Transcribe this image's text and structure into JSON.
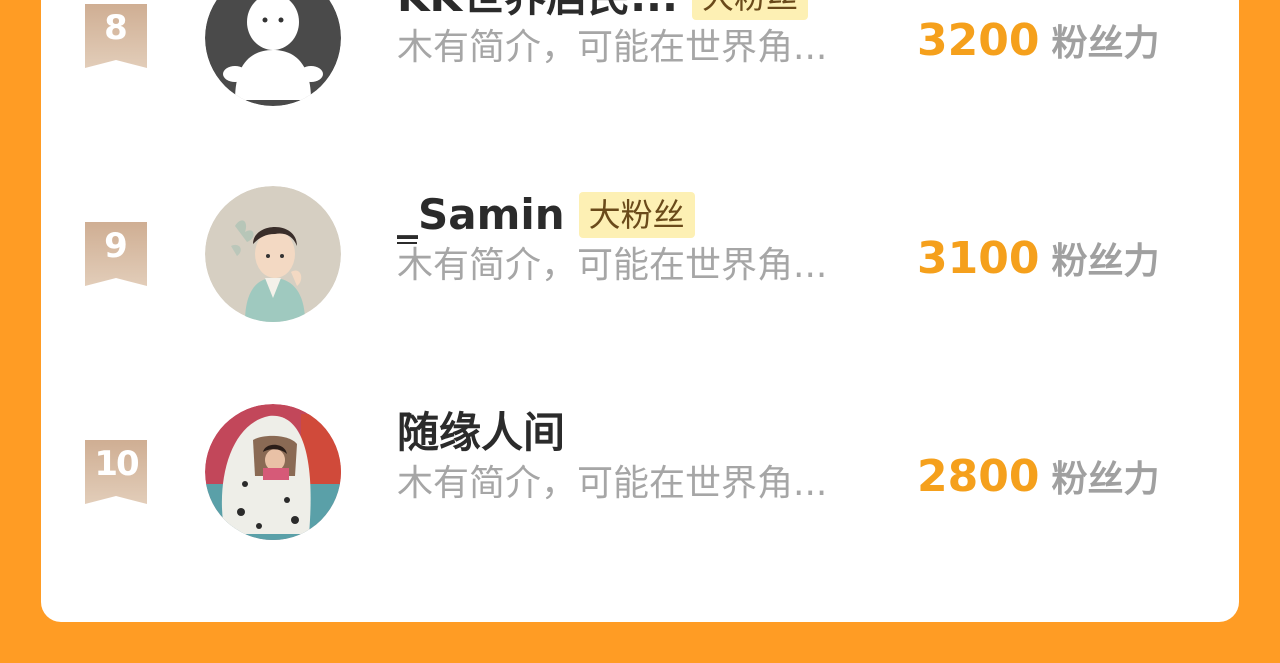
{
  "rows": [
    {
      "rank": "8",
      "name": "KK世界居民...",
      "badge": "大粉丝",
      "bio": "木有简介，可能在世界角...",
      "score": "3200",
      "unit": "粉丝力"
    },
    {
      "rank": "9",
      "name": "_Samin",
      "badge": "大粉丝",
      "bio": "木有简介，可能在世界角...",
      "score": "3100",
      "unit": "粉丝力"
    },
    {
      "rank": "10",
      "name": "随缘人间",
      "badge": "",
      "bio": "木有简介，可能在世界角...",
      "score": "2800",
      "unit": "粉丝力"
    }
  ],
  "colors": {
    "background": "#ff9c24",
    "card": "#ffffff",
    "score": "#f5a01c",
    "badge_bg": "#fdf0b4",
    "rank_ribbon": "#d8b9a0"
  }
}
